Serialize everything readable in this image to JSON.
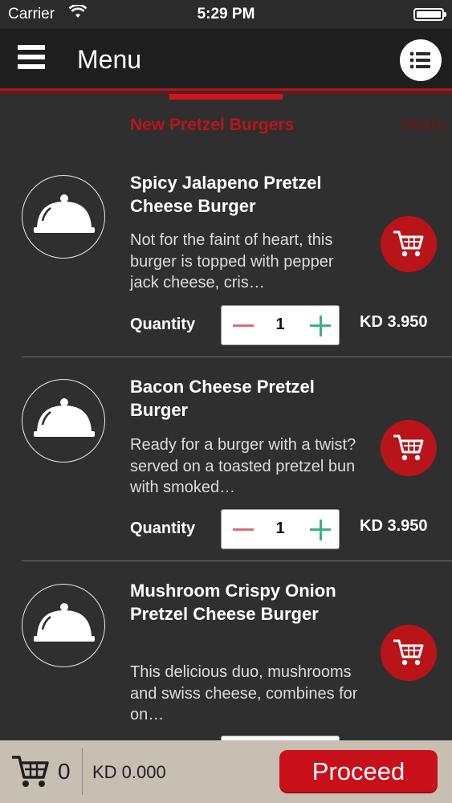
{
  "status_bar": {
    "carrier": "Carrier",
    "time": "5:29 PM"
  },
  "nav": {
    "title": "Menu"
  },
  "tabs": [
    {
      "label": "New Pretzel Burgers"
    },
    {
      "label": "Share"
    }
  ],
  "items": [
    {
      "name": "Spicy Jalapeno Pretzel Cheese Burger",
      "desc": "Not for the faint of heart, this burger is topped with pepper jack cheese, cris…",
      "qty_label": "Quantity",
      "qty": "1",
      "price": "KD 3.950"
    },
    {
      "name": "Bacon Cheese Pretzel Burger",
      "desc": "Ready for a burger with a twist? served on a toasted pretzel bun with smoked…",
      "qty_label": "Quantity",
      "qty": "1",
      "price": "KD 3.950"
    },
    {
      "name": "Mushroom Crispy Onion Pretzel Cheese Burger",
      "desc": "This delicious duo, mushrooms and swiss cheese, combines for on…"
    }
  ],
  "bottom": {
    "count": "0",
    "total": "KD 0.000",
    "proceed": "Proceed"
  },
  "colors": {
    "accent": "#b8141a",
    "background": "#2f2f2f",
    "bottom_bar": "#c7bfb2"
  }
}
